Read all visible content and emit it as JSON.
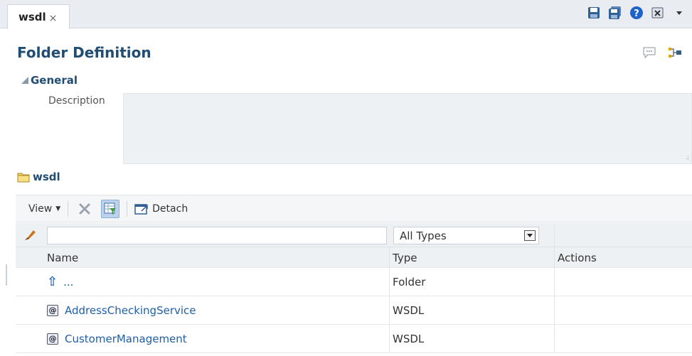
{
  "tab": {
    "label": "wsdl",
    "close": "×"
  },
  "toolbar": {
    "icons": [
      "save-icon",
      "save-all-icon",
      "help-icon",
      "close-window-icon",
      "dropdown-caret-icon"
    ]
  },
  "page": {
    "title": "Folder Definition",
    "icons": [
      "comment-icon",
      "hierarchy-icon"
    ]
  },
  "general": {
    "label": "General",
    "description_label": "Description",
    "description_value": ""
  },
  "folder": {
    "label": "wsdl"
  },
  "table_toolbar": {
    "view_label": "View",
    "detach_label": "Detach"
  },
  "filter": {
    "name_value": "",
    "type_value": "All Types"
  },
  "columns": {
    "name": "Name",
    "type": "Type",
    "actions": "Actions"
  },
  "rows": [
    {
      "name": "...",
      "type": "Folder",
      "icon": "up-arrow-icon"
    },
    {
      "name": "AddressCheckingService",
      "type": "WSDL",
      "icon": "wsdl-icon"
    },
    {
      "name": "CustomerManagement",
      "type": "WSDL",
      "icon": "wsdl-icon"
    }
  ],
  "colors": {
    "title": "#214d72",
    "link": "#1f5fa8",
    "header_bg": "#eef1f4"
  }
}
